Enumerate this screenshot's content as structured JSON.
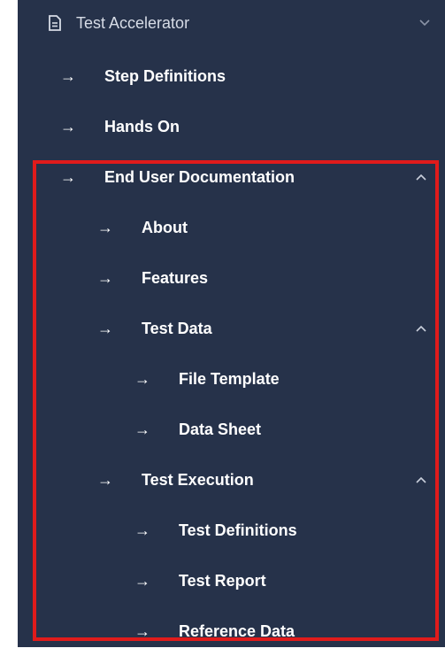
{
  "colors": {
    "sidebar_bg": "#26324a",
    "text": "#ffffff",
    "highlight": "#e01b1b"
  },
  "sidebar": {
    "top_item": {
      "label": "Test Accelerator",
      "icon": "document-icon",
      "chevron": "chevron-down-icon"
    },
    "items": [
      {
        "label": "Step Definitions",
        "arrow": "→"
      },
      {
        "label": "Hands On",
        "arrow": "→"
      },
      {
        "label": "End User Documentation",
        "arrow": "→",
        "chevron": "chevron-up-icon",
        "children": [
          {
            "label": "About",
            "arrow": "→"
          },
          {
            "label": "Features",
            "arrow": "→"
          },
          {
            "label": "Test Data",
            "arrow": "→",
            "chevron": "chevron-up-icon",
            "children": [
              {
                "label": "File Template",
                "arrow": "→"
              },
              {
                "label": "Data Sheet",
                "arrow": "→"
              }
            ]
          },
          {
            "label": "Test Execution",
            "arrow": "→",
            "chevron": "chevron-up-icon",
            "children": [
              {
                "label": "Test Definitions",
                "arrow": "→"
              },
              {
                "label": "Test Report",
                "arrow": "→"
              },
              {
                "label": "Reference Data",
                "arrow": "→"
              }
            ]
          }
        ]
      }
    ]
  }
}
